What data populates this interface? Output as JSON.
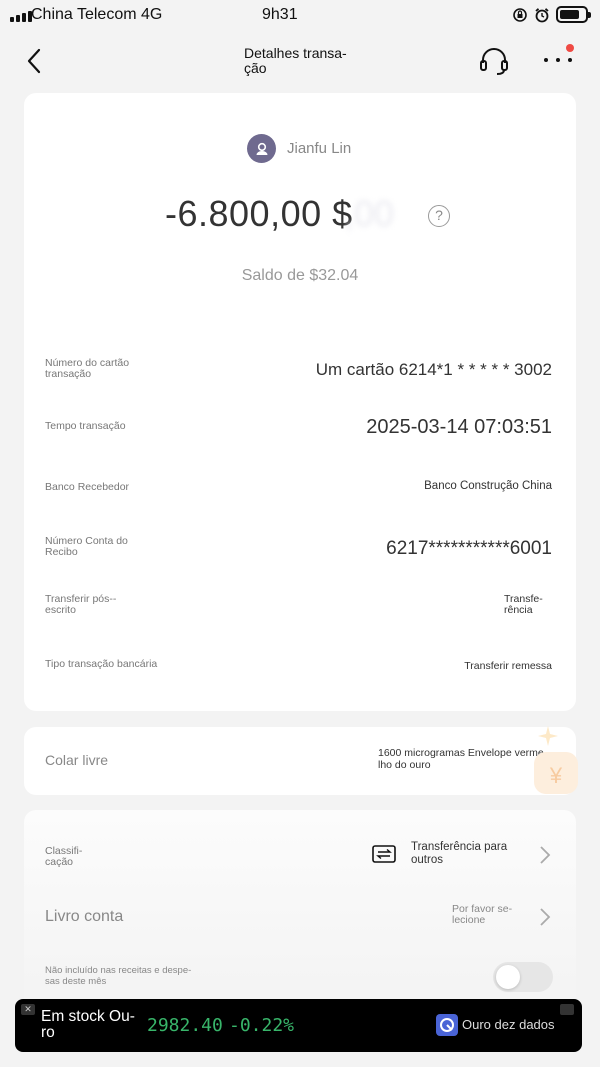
{
  "status_bar": {
    "carrier": "China Telecom 4G",
    "time": "9h31",
    "icons": [
      "signal-icon",
      "orientation-lock-icon",
      "alarm-icon",
      "battery-icon"
    ]
  },
  "nav": {
    "title": "Detalhes transa-ção",
    "icons": [
      "back-icon",
      "headset-icon",
      "more-icon"
    ]
  },
  "transaction": {
    "payee": "Jianfu Lin",
    "amount": "-6.800,00 $",
    "balance": "Saldo de $32.04",
    "help_glyph": "?"
  },
  "details": [
    {
      "label": "Número do cartão transação",
      "value": "Um cartão 6214*1 * * * * * 3002"
    },
    {
      "label": "Tempo transação",
      "value": "2025-03-14 07:03:51"
    },
    {
      "label": "Banco Recebedor",
      "value": "Banco Construção China"
    },
    {
      "label": "Número Conta do Recibo",
      "value": "6217***********6001"
    },
    {
      "label": "Transferir pós--escrito",
      "value": "Transfe-rência"
    },
    {
      "label": "Tipo transação bancária",
      "value": "Transferir remessa"
    }
  ],
  "note": {
    "label": "Colar livre",
    "value": "1600 microgramas Envelope verme-lho do ouro"
  },
  "classification": {
    "label": "Classifi-cação",
    "value": "Transferência para outros",
    "icon": "transfer-icon"
  },
  "account_book": {
    "label": "Livro conta",
    "value": "Por favor se-lecione"
  },
  "exclude": {
    "label": "Não incluído nas receitas e despe-sas deste mês",
    "toggle_on": false
  },
  "ticker": {
    "name": "Em stock Ou-ro",
    "price": "2982.40",
    "change": "-0.22%",
    "source": "Ouro dez dados",
    "close_glyph": "✕",
    "color": "#38b56a"
  }
}
